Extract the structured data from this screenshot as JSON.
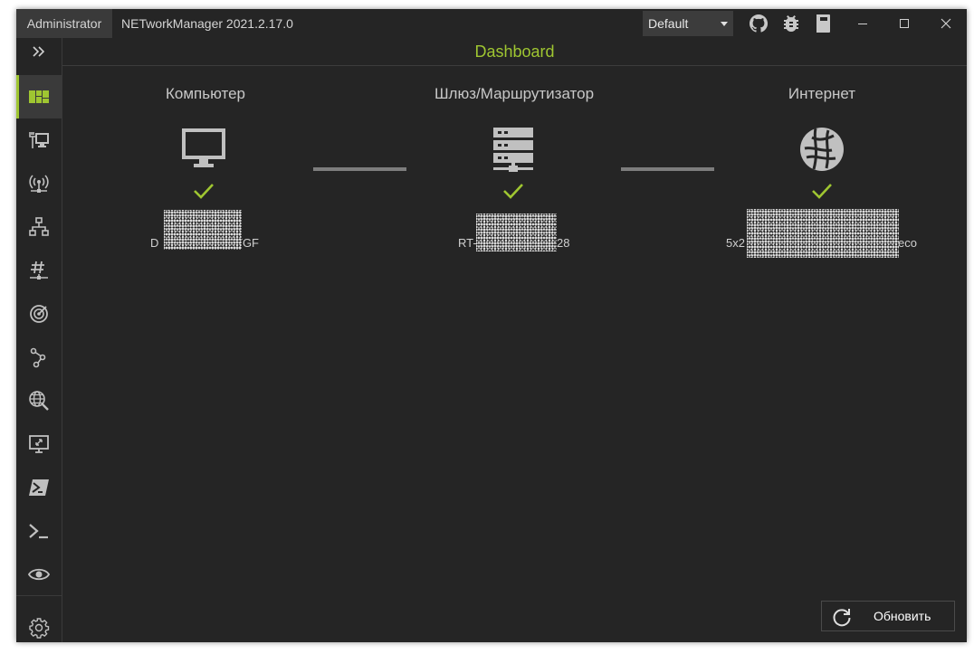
{
  "titlebar": {
    "admin_label": "Administrator",
    "app_title": "NETworkManager 2021.2.17.0",
    "profile": "Default",
    "icons": [
      "github-icon",
      "bug-icon",
      "book-icon"
    ],
    "window_buttons": [
      "minimize",
      "maximize",
      "close"
    ]
  },
  "sidebar": {
    "expand_icon": "double-chevron-right-icon",
    "items": [
      {
        "name": "dashboard",
        "icon": "dashboard-icon",
        "active": true
      },
      {
        "name": "network-interface",
        "icon": "network-interface-icon"
      },
      {
        "name": "wifi",
        "icon": "wifi-antenna-icon"
      },
      {
        "name": "ip-scanner",
        "icon": "network-scan-icon"
      },
      {
        "name": "port-scanner",
        "icon": "hash-icon"
      },
      {
        "name": "ping-monitor",
        "icon": "radar-icon"
      },
      {
        "name": "traceroute",
        "icon": "route-icon"
      },
      {
        "name": "dns-lookup",
        "icon": "globe-search-icon"
      },
      {
        "name": "remote-desktop",
        "icon": "remote-desktop-icon"
      },
      {
        "name": "powershell",
        "icon": "powershell-icon"
      },
      {
        "name": "putty",
        "icon": "terminal-icon"
      },
      {
        "name": "tigervnc",
        "icon": "eye-icon"
      }
    ],
    "settings_icon": "gear-icon"
  },
  "header": {
    "title": "Dashboard"
  },
  "dashboard": {
    "nodes": [
      {
        "label": "Компьютер",
        "icon": "monitor-icon",
        "status": "ok",
        "text_left": "D",
        "text_right": "TGF"
      },
      {
        "label": "Шлюз/Маршрутизатор",
        "icon": "server-icon",
        "status": "ok",
        "text_left": "RT-",
        "text_right": "28"
      },
      {
        "label": "Интернет",
        "icon": "globe-icon",
        "status": "ok",
        "text_left": "5x2",
        "text_right": "eco"
      }
    ]
  },
  "refresh": {
    "label": "Обновить",
    "icon": "refresh-icon"
  },
  "colors": {
    "accent": "#9fc631",
    "background": "#252525",
    "panel": "#3a3a3a",
    "icon": "#c0c0c0"
  }
}
